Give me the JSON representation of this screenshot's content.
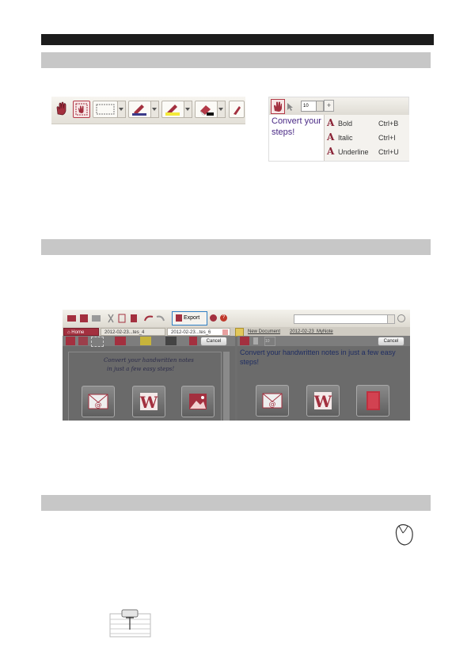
{
  "header_bar": "",
  "menu_popup": {
    "font_size": "10",
    "preview_text": "Convert your h",
    "preview_text_line2": "steps!",
    "items": [
      {
        "label": "Bold",
        "shortcut": "Ctrl+B"
      },
      {
        "label": "Italic",
        "shortcut": "Ctrl+I"
      },
      {
        "label": "Underline",
        "shortcut": "Ctrl+U"
      }
    ]
  },
  "app": {
    "export_label": "Export",
    "tabs": {
      "home": "Home",
      "tab1": "2012-02-23...tes_4",
      "tab2": "2012-02-23...tes_6",
      "new_doc": "New Document",
      "doc2": "2012-02-23_MyNote"
    },
    "cancel_left": "Cancel",
    "cancel_right": "Cancel",
    "font_size": "10",
    "handwriting_line1": "Convert your handwritten notes",
    "handwriting_line2": "in just a few easy steps!",
    "converted_text_line1": "Convert your handwritten notes in just a few easy",
    "converted_text_line2": "steps!"
  },
  "colors": {
    "accent": "#8a2437",
    "section_bar": "#c7c7c7",
    "header": "#1c1c1c"
  }
}
